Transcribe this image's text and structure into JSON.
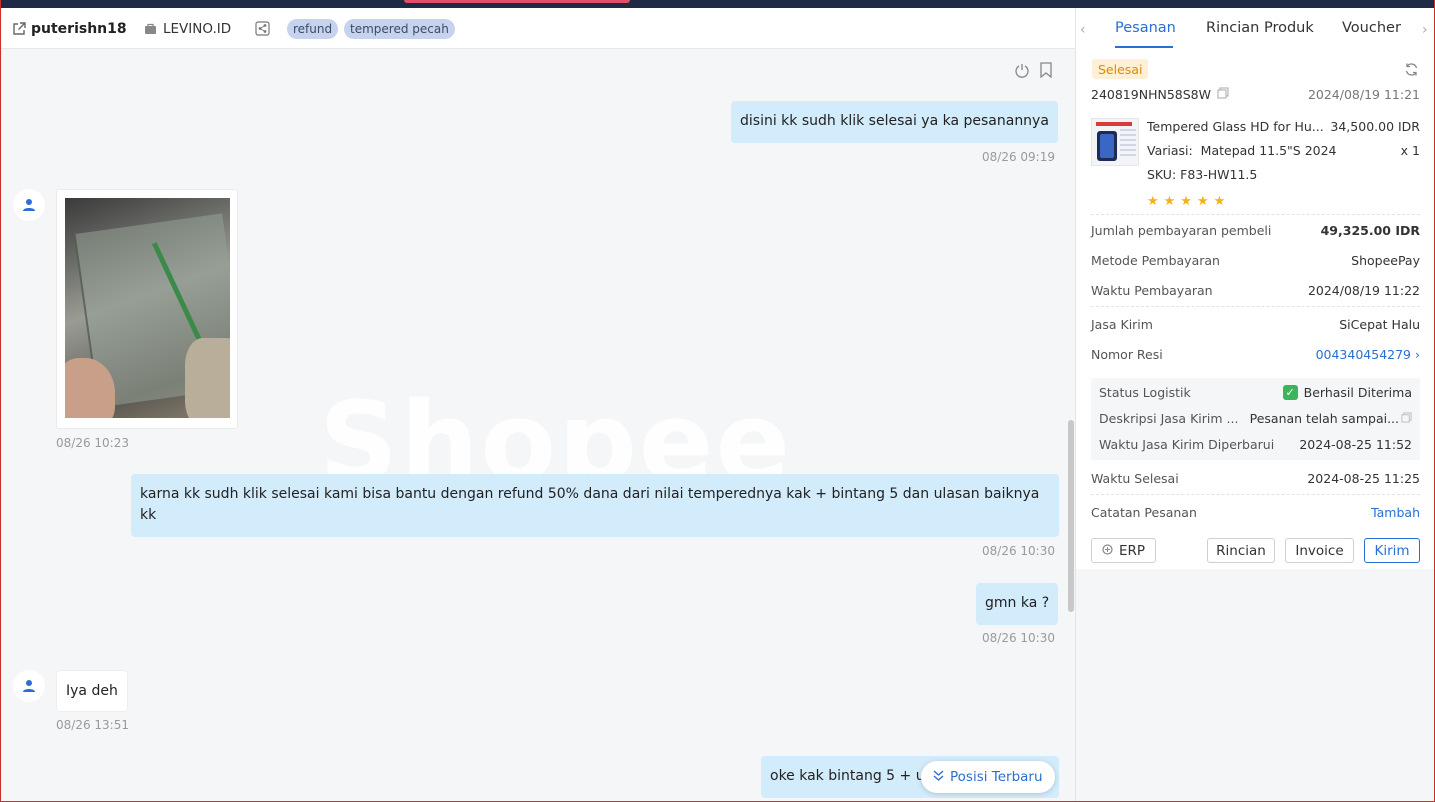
{
  "header": {
    "username": "puterishn18",
    "shop": "LEVINO.ID",
    "tags": [
      "refund",
      "tempered pecah"
    ]
  },
  "chat": {
    "watermark": "Shopee",
    "messages": [
      {
        "dir": "out",
        "text": "disini kk sudh klik selesai ya ka pesanannya",
        "time": "08/26 09:19"
      },
      {
        "dir": "in",
        "type": "image",
        "time": "08/26 10:23"
      },
      {
        "dir": "out",
        "text": "karna kk sudh klik selesai kami bisa bantu dengan refund 50% dana dari nilai temperednya kak + bintang 5 dan ulasan baiknya kk",
        "time": "08/26 10:30"
      },
      {
        "dir": "out",
        "text": "gmn ka ?",
        "time": "08/26 10:30"
      },
      {
        "dir": "in",
        "text": "Iya deh",
        "time": "08/26 13:51"
      },
      {
        "dir": "out",
        "text": "oke kak  bintang 5 + u"
      }
    ],
    "jump_label": "Posisi Terbaru"
  },
  "order": {
    "tabs": [
      "Pesanan",
      "Rincian Produk",
      "Voucher"
    ],
    "active_tab": "Pesanan",
    "status": "Selesai",
    "order_id": "240819NHN58S8W",
    "order_time": "2024/08/19 11:21",
    "product": {
      "name": "Tempered Glass HD for Hu...",
      "price": "34,500.00 IDR",
      "variant_label": "Variasi:",
      "variant": "Matepad 11.5\"S 2024",
      "qty": "x 1",
      "sku_label": "SKU:",
      "sku": "F83-HW11.5",
      "rating": 5,
      "stars": "★★★★★"
    },
    "payment": {
      "total_label": "Jumlah pembayaran pembeli",
      "total": "49,325.00 IDR",
      "method_label": "Metode Pembayaran",
      "method": "ShopeePay",
      "time_label": "Waktu Pembayaran",
      "time": "2024/08/19 11:22"
    },
    "shipping": {
      "courier_label": "Jasa Kirim",
      "courier": "SiCepat Halu",
      "resi_label": "Nomor Resi",
      "resi": "004340454279"
    },
    "logistics": {
      "status_label": "Status Logistik",
      "status": "Berhasil Diterima",
      "desc_label": "Deskripsi Jasa Kirim ...",
      "desc": "Pesanan telah sampai...",
      "updated_label": "Waktu Jasa Kirim Diperbarui",
      "updated": "2024-08-25 11:52"
    },
    "completed_label": "Waktu Selesai",
    "completed": "2024-08-25 11:25",
    "note_label": "Catatan Pesanan",
    "note_action": "Tambah",
    "buttons": {
      "erp": "ERP",
      "detail": "Rincian",
      "invoice": "Invoice",
      "send": "Kirim"
    }
  }
}
